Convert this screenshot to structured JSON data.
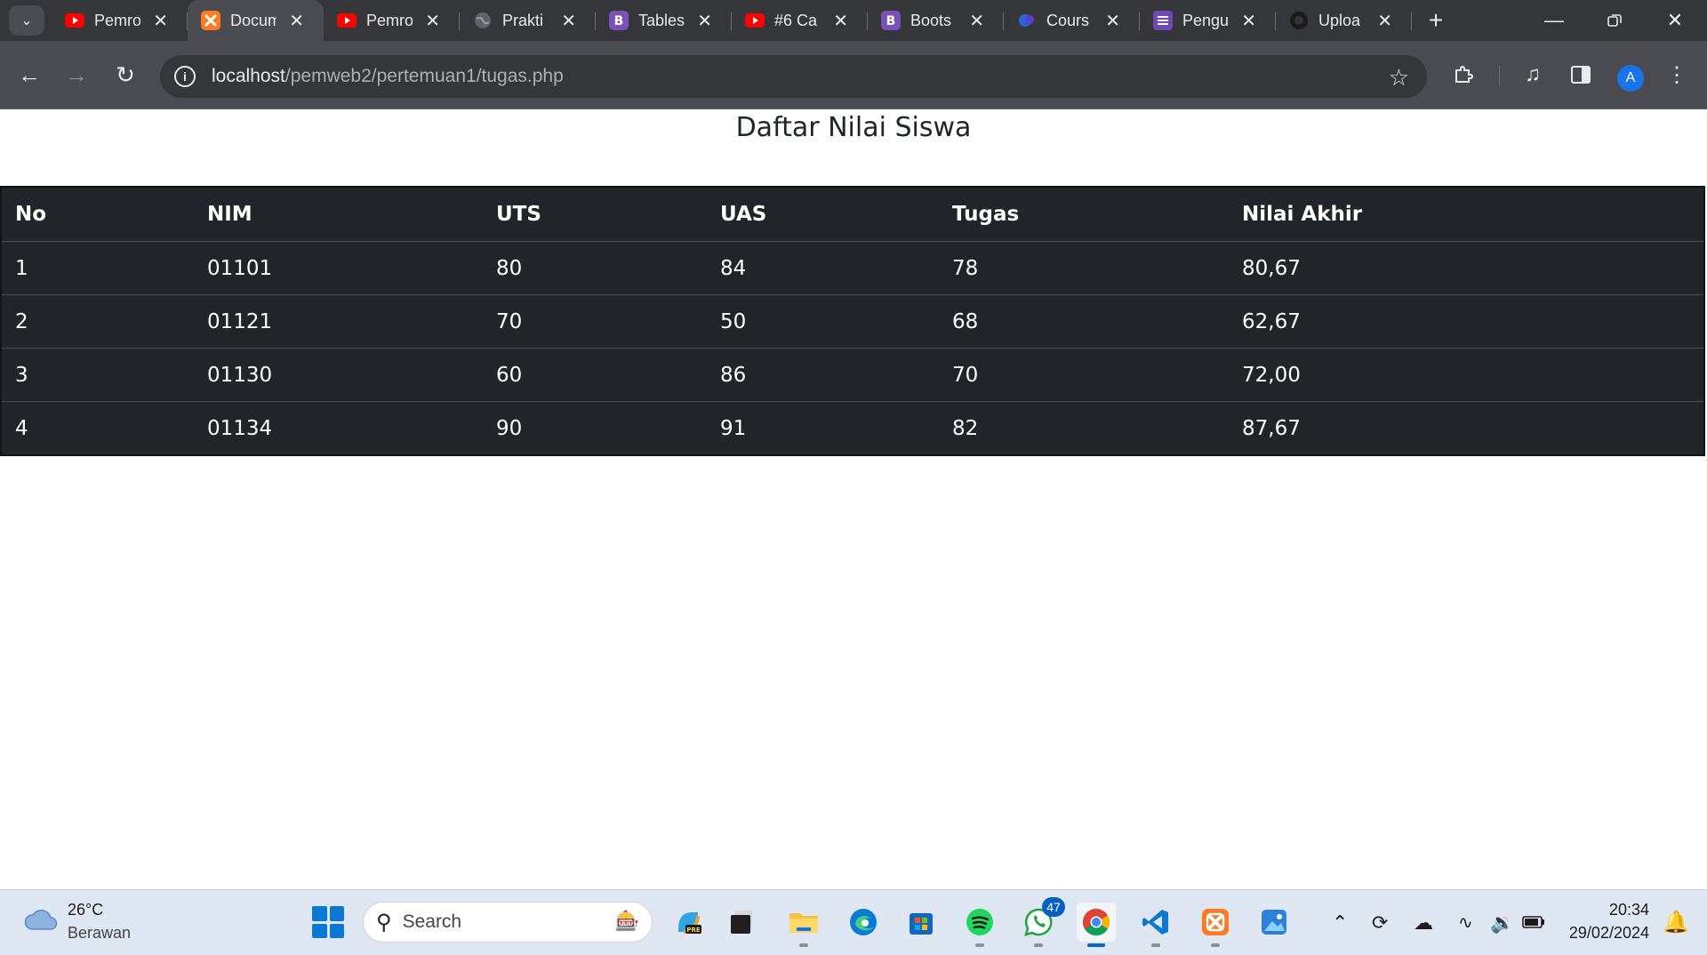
{
  "browser": {
    "tabs": [
      {
        "title": "Pemro",
        "icon": "youtube-icon",
        "active": false
      },
      {
        "title": "Docum",
        "icon": "xampp-icon",
        "active": true
      },
      {
        "title": "Pemro",
        "icon": "youtube-icon",
        "active": false
      },
      {
        "title": "Prakti",
        "icon": "globe-icon",
        "active": false
      },
      {
        "title": "Tables",
        "icon": "bootstrap-icon",
        "active": false
      },
      {
        "title": "#6 Ca",
        "icon": "youtube-icon",
        "active": false
      },
      {
        "title": "Boots",
        "icon": "bootstrap-icon",
        "active": false
      },
      {
        "title": "Cours",
        "icon": "course-icon",
        "active": false
      },
      {
        "title": "Pengu",
        "icon": "form-icon",
        "active": false
      },
      {
        "title": "Uploa",
        "icon": "github-icon",
        "active": false
      }
    ],
    "url_host": "localhost",
    "url_path": "/pemweb2/pertemuan1/tugas.php",
    "profile_initial": "A",
    "colors": {
      "youtube": "#ff0000",
      "bootstrap": "#7952b3",
      "xampp": "#fb7a24",
      "accent": "#1a73e8"
    }
  },
  "page": {
    "title": "Daftar Nilai Siswa",
    "table": {
      "headers": [
        "No",
        "NIM",
        "UTS",
        "UAS",
        "Tugas",
        "Nilai Akhir"
      ],
      "rows": [
        [
          "1",
          "01101",
          "80",
          "84",
          "78",
          "80,67"
        ],
        [
          "2",
          "01121",
          "70",
          "50",
          "68",
          "62,67"
        ],
        [
          "3",
          "01130",
          "60",
          "86",
          "70",
          "72,00"
        ],
        [
          "4",
          "01134",
          "90",
          "91",
          "82",
          "87,67"
        ]
      ]
    }
  },
  "taskbar": {
    "weather_temp": "26°C",
    "weather_desc": "Berawan",
    "search_placeholder": "Search",
    "whatsapp_badge": "47",
    "clock_time": "20:34",
    "clock_date": "29/02/2024"
  }
}
